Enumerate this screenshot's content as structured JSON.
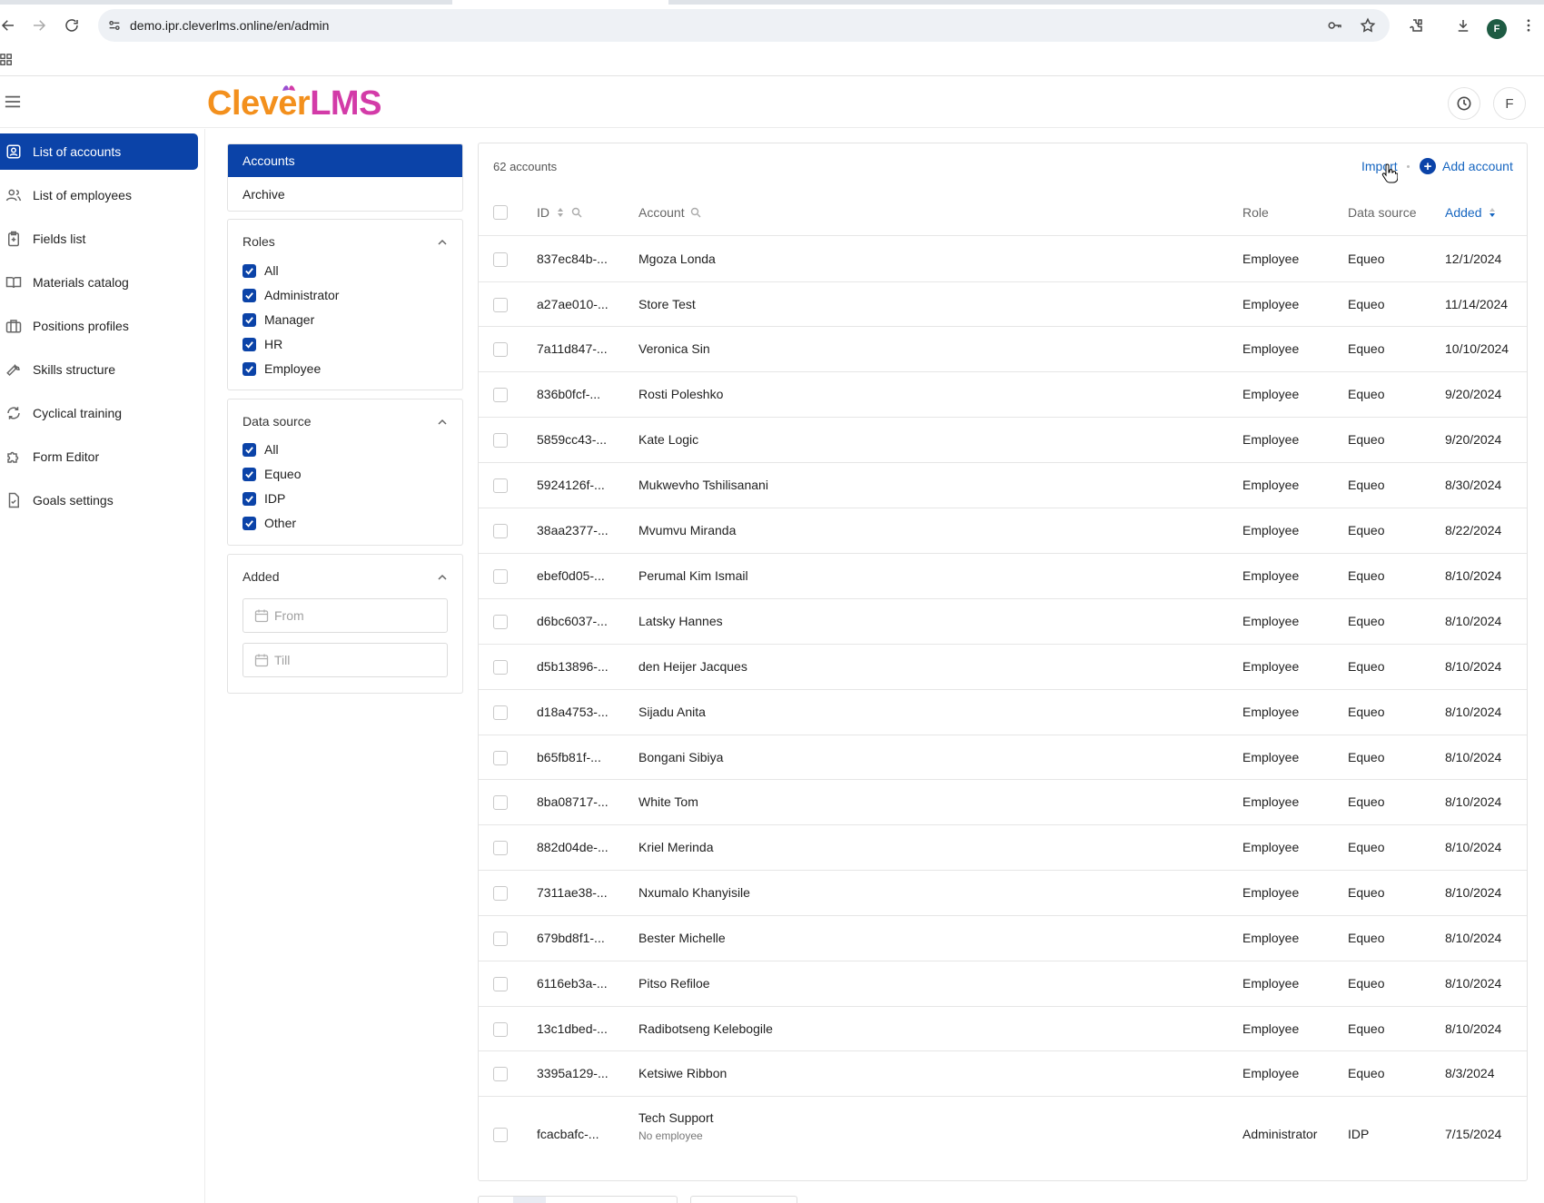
{
  "browser": {
    "url": "demo.ipr.cleverlms.online/en/admin",
    "profile_initial": "F"
  },
  "header": {
    "logo_part1": "Clever",
    "logo_part2": "LMS",
    "user_initial": "F"
  },
  "sidebar": {
    "items": [
      {
        "label": "List of accounts",
        "icon": "user-square-icon",
        "active": true
      },
      {
        "label": "List of employees",
        "icon": "users-icon"
      },
      {
        "label": "Fields list",
        "icon": "clipboard-plus-icon"
      },
      {
        "label": "Materials catalog",
        "icon": "book-open-icon"
      },
      {
        "label": "Positions profiles",
        "icon": "briefcase-icon"
      },
      {
        "label": "Skills structure",
        "icon": "wrench-icon"
      },
      {
        "label": "Cyclical training",
        "icon": "refresh-icon"
      },
      {
        "label": "Form Editor",
        "icon": "puzzle-icon"
      },
      {
        "label": "Goals settings",
        "icon": "file-check-icon"
      }
    ]
  },
  "filters": {
    "tabs": [
      "Accounts",
      "Archive"
    ],
    "roles": {
      "title": "Roles",
      "options": [
        "All",
        "Administrator",
        "Manager",
        "HR",
        "Employee"
      ]
    },
    "data_source": {
      "title": "Data source",
      "options": [
        "All",
        "Equeo",
        "IDP",
        "Other"
      ]
    },
    "added": {
      "title": "Added",
      "from_placeholder": "From",
      "till_placeholder": "Till"
    }
  },
  "table": {
    "count_label": "62 accounts",
    "import_label": "Import",
    "add_label": "Add account",
    "columns": {
      "id": "ID",
      "account": "Account",
      "role": "Role",
      "source": "Data source",
      "added": "Added"
    },
    "rows": [
      {
        "id": "837ec84b-...",
        "account": "Mgoza Londa",
        "role": "Employee",
        "source": "Equeo",
        "added": "12/1/2024"
      },
      {
        "id": "a27ae010-...",
        "account": "Store Test",
        "role": "Employee",
        "source": "Equeo",
        "added": "11/14/2024"
      },
      {
        "id": "7a11d847-...",
        "account": "Veronica Sin",
        "role": "Employee",
        "source": "Equeo",
        "added": "10/10/2024"
      },
      {
        "id": "836b0fcf-...",
        "account": "Rosti Poleshko",
        "role": "Employee",
        "source": "Equeo",
        "added": "9/20/2024"
      },
      {
        "id": "5859cc43-...",
        "account": "Kate Logic",
        "role": "Employee",
        "source": "Equeo",
        "added": "9/20/2024"
      },
      {
        "id": "5924126f-...",
        "account": "Mukwevho Tshilisanani",
        "role": "Employee",
        "source": "Equeo",
        "added": "8/30/2024"
      },
      {
        "id": "38aa2377-...",
        "account": "Mvumvu Miranda",
        "role": "Employee",
        "source": "Equeo",
        "added": "8/22/2024"
      },
      {
        "id": "ebef0d05-...",
        "account": "Perumal Kim Ismail",
        "role": "Employee",
        "source": "Equeo",
        "added": "8/10/2024"
      },
      {
        "id": "d6bc6037-...",
        "account": "Latsky Hannes",
        "role": "Employee",
        "source": "Equeo",
        "added": "8/10/2024"
      },
      {
        "id": "d5b13896-...",
        "account": "den Heijer Jacques",
        "role": "Employee",
        "source": "Equeo",
        "added": "8/10/2024"
      },
      {
        "id": "d18a4753-...",
        "account": "Sijadu Anita",
        "role": "Employee",
        "source": "Equeo",
        "added": "8/10/2024"
      },
      {
        "id": "b65fb81f-...",
        "account": "Bongani Sibiya",
        "role": "Employee",
        "source": "Equeo",
        "added": "8/10/2024"
      },
      {
        "id": "8ba08717-...",
        "account": "White Tom",
        "role": "Employee",
        "source": "Equeo",
        "added": "8/10/2024"
      },
      {
        "id": "882d04de-...",
        "account": "Kriel Merinda",
        "role": "Employee",
        "source": "Equeo",
        "added": "8/10/2024"
      },
      {
        "id": "7311ae38-...",
        "account": "Nxumalo Khanyisile",
        "role": "Employee",
        "source": "Equeo",
        "added": "8/10/2024"
      },
      {
        "id": "679bd8f1-...",
        "account": "Bester Michelle",
        "role": "Employee",
        "source": "Equeo",
        "added": "8/10/2024"
      },
      {
        "id": "6116eb3a-...",
        "account": "Pitso Refiloe",
        "role": "Employee",
        "source": "Equeo",
        "added": "8/10/2024"
      },
      {
        "id": "13c1dbed-...",
        "account": "Radibotseng Kelebogile",
        "role": "Employee",
        "source": "Equeo",
        "added": "8/10/2024"
      },
      {
        "id": "3395a129-...",
        "account": "Ketsiwe Ribbon",
        "role": "Employee",
        "source": "Equeo",
        "added": "8/3/2024"
      },
      {
        "id": "fcacbafc-...",
        "account": "Tech Support",
        "sub": "No employee",
        "role": "Administrator",
        "source": "IDP",
        "added": "7/15/2024"
      }
    ]
  },
  "colors": {
    "primary": "#0b43a8",
    "link": "#1565c0",
    "logo_orange": "#f3901d",
    "logo_pink": "#d33ba8"
  }
}
